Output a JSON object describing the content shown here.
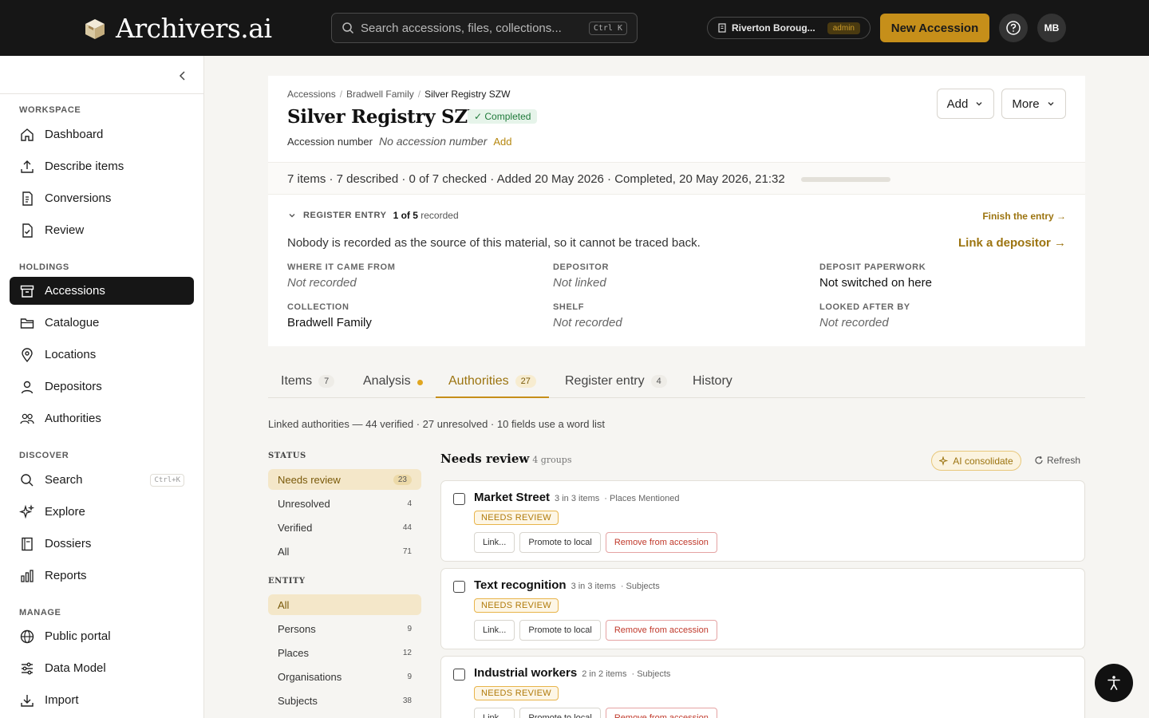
{
  "app": {
    "name": "Archivers.ai"
  },
  "search": {
    "placeholder": "Search accessions, files, collections...",
    "shortcut": "Ctrl K"
  },
  "org": {
    "name": "Riverton Boroug...",
    "role": "admin"
  },
  "header_actions": {
    "new_accession": "New Accession",
    "avatar_initials": "MB"
  },
  "sidebar": {
    "sections": [
      {
        "label": "WORKSPACE",
        "items": [
          "Dashboard",
          "Describe items",
          "Conversions",
          "Review"
        ]
      },
      {
        "label": "HOLDINGS",
        "items": [
          "Accessions",
          "Catalogue",
          "Locations",
          "Depositors",
          "Authorities"
        ]
      },
      {
        "label": "DISCOVER",
        "items": [
          "Search",
          "Explore",
          "Dossiers",
          "Reports"
        ]
      },
      {
        "label": "MANAGE",
        "items": [
          "Public portal",
          "Data Model",
          "Import"
        ]
      }
    ],
    "active": "Accessions",
    "search_shortcut": "Ctrl+K"
  },
  "breadcrumb": [
    "Accessions",
    "Bradwell Family",
    "Silver Registry SZW"
  ],
  "accession": {
    "title": "Silver Registry SZW",
    "status": "✓ Completed",
    "number_label": "Accession number",
    "number_value": "No accession number",
    "add_link": "Add",
    "add_button": "Add",
    "more_button": "More",
    "stats": "7 items · 7 described · 0 of 7 checked · Added 20 May 2026 · Completed, 20 May 2026, 21:32",
    "progress": 0
  },
  "register": {
    "heading": "REGISTER ENTRY",
    "count_bold": "1 of 5",
    "count_rest": "recorded",
    "finish_link": "Finish the entry →",
    "warning": "Nobody is recorded as the source of this material, so it cannot be traced back.",
    "link_depositor": "Link a depositor →",
    "fields": [
      {
        "label": "WHERE IT CAME FROM",
        "value": "Not recorded",
        "empty": true
      },
      {
        "label": "DEPOSITOR",
        "value": "Not linked",
        "empty": true
      },
      {
        "label": "DEPOSIT PAPERWORK",
        "value": "Not switched on here",
        "empty": false
      },
      {
        "label": "COLLECTION",
        "value": "Bradwell Family",
        "empty": false
      },
      {
        "label": "SHELF",
        "value": "Not recorded",
        "empty": true
      },
      {
        "label": "LOOKED AFTER BY",
        "value": "Not recorded",
        "empty": true
      }
    ]
  },
  "tabs": [
    {
      "label": "Items",
      "count": "7"
    },
    {
      "label": "Analysis",
      "count": ""
    },
    {
      "label": "Authorities",
      "count": "27"
    },
    {
      "label": "Register entry",
      "count": "4"
    },
    {
      "label": "History",
      "count": ""
    }
  ],
  "summary": "Linked authorities — 44 verified · 27 unresolved · 10 fields use a word list",
  "filters": {
    "status_head": "STATUS",
    "status": [
      {
        "label": "Needs review",
        "count": "23"
      },
      {
        "label": "Unresolved",
        "count": "4"
      },
      {
        "label": "Verified",
        "count": "44"
      },
      {
        "label": "All",
        "count": "71"
      }
    ],
    "entity_head": "ENTITY",
    "entity": [
      {
        "label": "All",
        "count": ""
      },
      {
        "label": "Persons",
        "count": "9"
      },
      {
        "label": "Places",
        "count": "12"
      },
      {
        "label": "Organisations",
        "count": "9"
      },
      {
        "label": "Subjects",
        "count": "38"
      }
    ]
  },
  "group": {
    "title": "Needs review",
    "sub": "4 groups",
    "ai_button": "AI consolidate",
    "refresh": "Refresh"
  },
  "cards": [
    {
      "title": "Market Street",
      "meta": "3 in 3 items",
      "field": "· Places Mentioned",
      "badge": "NEEDS REVIEW"
    },
    {
      "title": "Text recognition",
      "meta": "3 in 3 items",
      "field": "· Subjects",
      "badge": "NEEDS REVIEW"
    },
    {
      "title": "Industrial workers",
      "meta": "2 in 2 items",
      "field": "· Subjects",
      "badge": "NEEDS REVIEW"
    }
  ],
  "card_actions": {
    "link": "Link...",
    "promote": "Promote to local",
    "remove": "Remove from accession"
  }
}
